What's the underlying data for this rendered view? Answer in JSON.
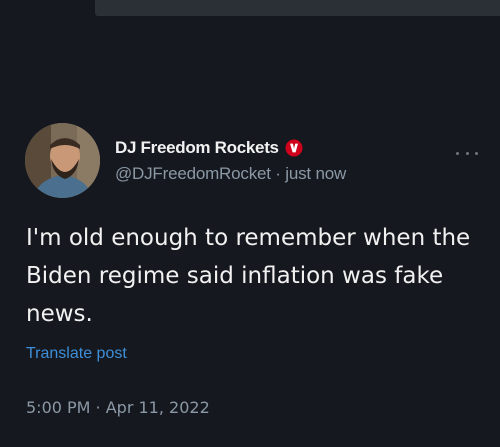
{
  "tweet": {
    "display_name": "DJ Freedom Rockets",
    "handle": "@DJFreedomRocket",
    "separator": " · ",
    "time_ago": "just now",
    "text_lines": [
      "I'm old enough to remember when the",
      "Biden regime said inflation was fake",
      "news."
    ],
    "translate_label": "Translate post",
    "time": "5:00 PM",
    "date": "Apr 11, 2022"
  },
  "icons": {
    "badge": "verified-badge-icon",
    "more": "more-options-icon"
  },
  "colors": {
    "background": "#15181e",
    "text_primary": "#f1f1f1",
    "text_secondary": "#8b98a5",
    "link": "#3d8fd9",
    "badge": "#d0021b"
  }
}
